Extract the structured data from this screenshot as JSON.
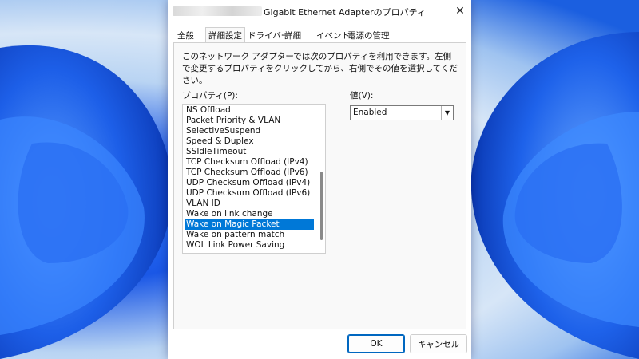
{
  "dialog": {
    "title": "Gigabit Ethernet Adapterのプロパティ",
    "close_icon": "close-icon"
  },
  "tabs": [
    {
      "label": "全般"
    },
    {
      "label": "詳細設定"
    },
    {
      "label": "ドライバー"
    },
    {
      "label": "詳細"
    },
    {
      "label": "イベント"
    },
    {
      "label": "電源の管理"
    }
  ],
  "active_tab": "詳細設定",
  "panel": {
    "description": "このネットワーク アダプターでは次のプロパティを利用できます。左側で変更するプロパティをクリックしてから、右側でその値を選択してください。",
    "property_label": "プロパティ(P):",
    "value_label": "値(V):"
  },
  "properties": [
    "NS Offload",
    "Packet Priority & VLAN",
    "SelectiveSuspend",
    "Speed & Duplex",
    "SSIdleTimeout",
    "TCP Checksum Offload (IPv4)",
    "TCP Checksum Offload (IPv6)",
    "UDP Checksum Offload (IPv4)",
    "UDP Checksum Offload (IPv6)",
    "VLAN ID",
    "Wake on link change",
    "Wake on Magic Packet",
    "Wake on pattern match",
    "WOL Link Power Saving"
  ],
  "selected_property": "Wake on Magic Packet",
  "value_select": {
    "selected": "Enabled"
  },
  "buttons": {
    "ok": "OK",
    "cancel": "キャンセル"
  },
  "colors": {
    "selection": "#0078d7",
    "accent": "#0067c0"
  }
}
